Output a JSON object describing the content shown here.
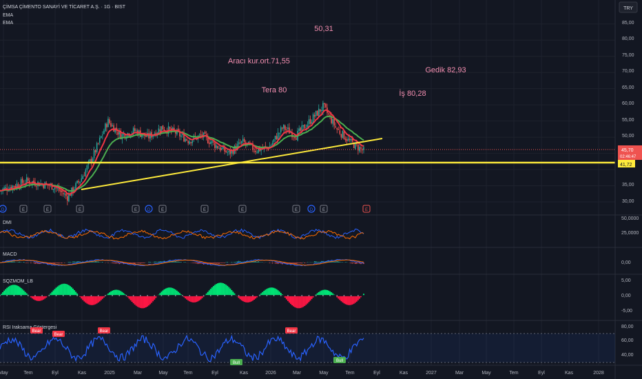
{
  "header": {
    "symbol": "ÇİMSA ÇİMENTO SANAYİ VE TİCARET A.Ş. · 1G · BIST",
    "ind1": "EMA",
    "ind2": "EMA",
    "currency": "TRY"
  },
  "annotations": [
    {
      "text": "50,31"
    },
    {
      "text": "Aracı kur.ort.71,55"
    },
    {
      "text": "Gedik 82,93"
    },
    {
      "text": "Tera 80"
    },
    {
      "text": "İş 80,28"
    }
  ],
  "price_axis": {
    "ticks": [
      "85,00",
      "80,00",
      "75,00",
      "70,00",
      "65,00",
      "60,00",
      "55,00",
      "50,00",
      "45,00",
      "35,00",
      "30,00"
    ],
    "current": "45,70",
    "countdown": "02:46:47",
    "hline": "41,72"
  },
  "time_axis": [
    "May",
    "Tem",
    "Eyl",
    "Kas",
    "2025",
    "Mar",
    "May",
    "Tem",
    "Eyl",
    "Kas",
    "2026",
    "Mar",
    "May",
    "Tem",
    "Eyl",
    "Kas",
    "2027",
    "Mar",
    "May",
    "Tem",
    "Eyl",
    "Kas",
    "2028"
  ],
  "panes": {
    "dmi": {
      "label": "DMI",
      "ticks": [
        "50,0000",
        "25,0000"
      ]
    },
    "macd": {
      "label": "MACD",
      "ticks": [
        "0,00"
      ]
    },
    "sqz": {
      "label": "SQZMOM_LB",
      "ticks": [
        "5,00",
        "0,00",
        "-5,00"
      ]
    },
    "rsi": {
      "label": "RSI Iraksama Göstergesi",
      "ticks": [
        "80,00",
        "60,00",
        "40,00"
      ]
    }
  },
  "event_badges": [
    "D",
    "E",
    "E",
    "E",
    "E",
    "D",
    "E",
    "E",
    "E",
    "E",
    "D",
    "E",
    "E"
  ],
  "rsi_labels": [
    "Bear",
    "Bear",
    "Bear",
    "Bear",
    "Bull",
    "Bull"
  ],
  "colors": {
    "bg": "#131722",
    "up": "#26a69a",
    "down": "#ef5350",
    "ema_fast": "#f23645",
    "ema_slow": "#4caf50",
    "trend": "#ffeb3b",
    "dmi_plus": "#2962ff",
    "dmi_minus": "#ff6d00",
    "rsi": "#2962ff",
    "sqz_up": "#00e676",
    "sqz_down": "#ff1744"
  },
  "chart_data": {
    "type": "candlestick",
    "title": "ÇİMSA ÇİMENTO SANAYİ VE TİCARET A.Ş. · 1G · BIST",
    "ylim": [
      28,
      88
    ],
    "y_ticks": [
      30,
      35,
      45,
      50,
      55,
      60,
      65,
      70,
      75,
      80,
      85
    ],
    "price_path": [
      {
        "x": "2024-05",
        "y": 33.5
      },
      {
        "x": "2024-07",
        "y": 36.5
      },
      {
        "x": "2024-09",
        "y": 34.8
      },
      {
        "x": "2024-10",
        "y": 31.5
      },
      {
        "x": "2024-11",
        "y": 37.0
      },
      {
        "x": "2024-12",
        "y": 45.0
      },
      {
        "x": "2025-01",
        "y": 55.0
      },
      {
        "x": "2025-02",
        "y": 50.5
      },
      {
        "x": "2025-03",
        "y": 52.0
      },
      {
        "x": "2025-04",
        "y": 50.0
      },
      {
        "x": "2025-05",
        "y": 53.0
      },
      {
        "x": "2025-06",
        "y": 51.5
      },
      {
        "x": "2025-07",
        "y": 49.0
      },
      {
        "x": "2025-08",
        "y": 50.5
      },
      {
        "x": "2025-09",
        "y": 47.5
      },
      {
        "x": "2025-10",
        "y": 45.0
      },
      {
        "x": "2025-11",
        "y": 48.5
      },
      {
        "x": "2025-12",
        "y": 46.0
      },
      {
        "x": "2026-01",
        "y": 47.0
      },
      {
        "x": "2026-02",
        "y": 53.0
      },
      {
        "x": "2026-03",
        "y": 50.5
      },
      {
        "x": "2026-04",
        "y": 55.0
      },
      {
        "x": "2026-05",
        "y": 59.5
      },
      {
        "x": "2026-06",
        "y": 52.5
      },
      {
        "x": "2026-07",
        "y": 48.5
      },
      {
        "x": "2026-08",
        "y": 45.7
      }
    ],
    "hline": 41.72,
    "last": 45.7
  }
}
